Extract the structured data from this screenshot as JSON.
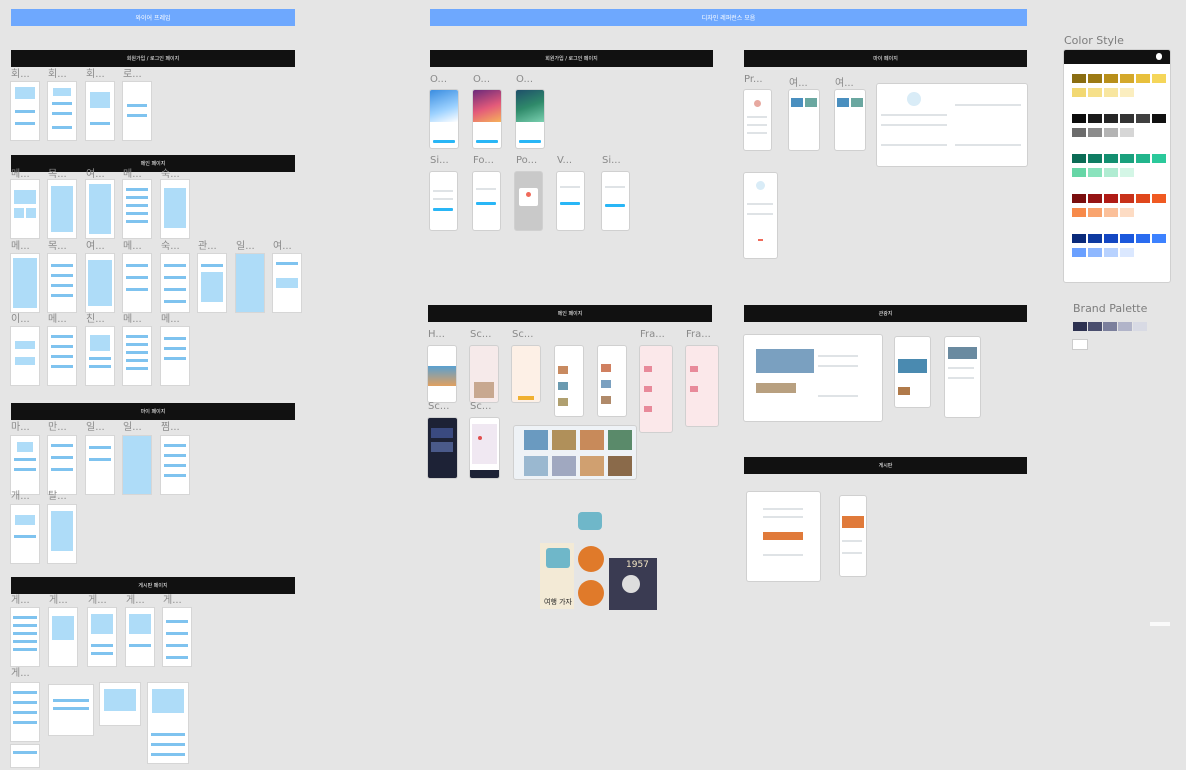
{
  "canvas": {
    "background": "#e5e5e5"
  },
  "left_column": {
    "top_banner": "와이어 프레임",
    "groups": [
      {
        "title": "회원가입 / 로그인 페이지",
        "frame_labels": [
          "회...",
          "회...",
          "회...",
          "로..."
        ]
      },
      {
        "title": "메인 페이지",
        "frame_labels": [
          "메...",
          "목...",
          "여...",
          "메...",
          "숙...",
          "관...",
          "일...",
          "여...",
          "이...",
          "메...",
          "친...",
          "메...",
          "메..."
        ]
      },
      {
        "title": "마이 페이지",
        "frame_labels": [
          "마...",
          "만...",
          "일...",
          "일...",
          "찜...",
          "개...",
          "탈..."
        ]
      },
      {
        "title": "게시판 페이지",
        "frame_labels": [
          "게...",
          "게...",
          "게...",
          "게...",
          "게...",
          "게..."
        ]
      }
    ]
  },
  "center_column": {
    "top_banner": "디자인 레퍼런스 모음",
    "groups": [
      {
        "title": "회원가입 / 로그인 페이지",
        "frame_labels": [
          "O...",
          "O...",
          "O...",
          "Si...",
          "Fo...",
          "Po...",
          "V...",
          "Si..."
        ]
      },
      {
        "title": "메인 페이지",
        "frame_labels": [
          "H...",
          "Sc...",
          "Sc...",
          "Fra...",
          "Fra...",
          "Sc...",
          "Sc..."
        ]
      },
      {
        "title": "마이 페이지",
        "frame_labels": [
          "Pr...",
          "여...",
          "여..."
        ]
      },
      {
        "title": "관광지",
        "frame_labels": []
      },
      {
        "title": "게시판",
        "frame_labels": []
      }
    ],
    "sticker_text": "여행 가자",
    "poster_year": "1957"
  },
  "styles": {
    "color_style_title": "Color Style",
    "brand_palette_title": "Brand Palette",
    "color_rows": [
      [
        "#8a6d12",
        "#9c7a14",
        "#b88f1a",
        "#d4a82a",
        "#e8c03c",
        "#f5d65a"
      ],
      [
        "#f2d872",
        "#f6e08a",
        "#f8e6a0",
        "#fbeec0"
      ],
      [
        "#0b0b0b",
        "#1a1a1a",
        "#262626",
        "#333333",
        "#404040",
        "#111111"
      ],
      [
        "#6c6c6c",
        "#8c8c8c",
        "#b4b4b4",
        "#d6d6d6"
      ],
      [
        "#0b6b55",
        "#0f7d63",
        "#138f70",
        "#1aa07d",
        "#22b58c",
        "#2bc99b"
      ],
      [
        "#66d6a6",
        "#8ae3bd",
        "#b0ecd2",
        "#d4f6e6"
      ],
      [
        "#7a0e0e",
        "#951414",
        "#b01b16",
        "#c8321a",
        "#e0471c",
        "#f05a22"
      ],
      [
        "#f78a4a",
        "#f9a46e",
        "#fbc09a",
        "#fddcc4"
      ],
      [
        "#0a2a7a",
        "#0e3aa0",
        "#1447c2",
        "#1b58dc",
        "#2a6cf0",
        "#3d82ff"
      ],
      [
        "#6aa0ff",
        "#8fb8ff",
        "#b8d2ff",
        "#dbe8ff"
      ]
    ],
    "brand_colors": [
      "#2d3150",
      "#4a4e6e",
      "#7b7f9c",
      "#b1b4c9",
      "#d8dae4",
      "#ffffff"
    ]
  }
}
